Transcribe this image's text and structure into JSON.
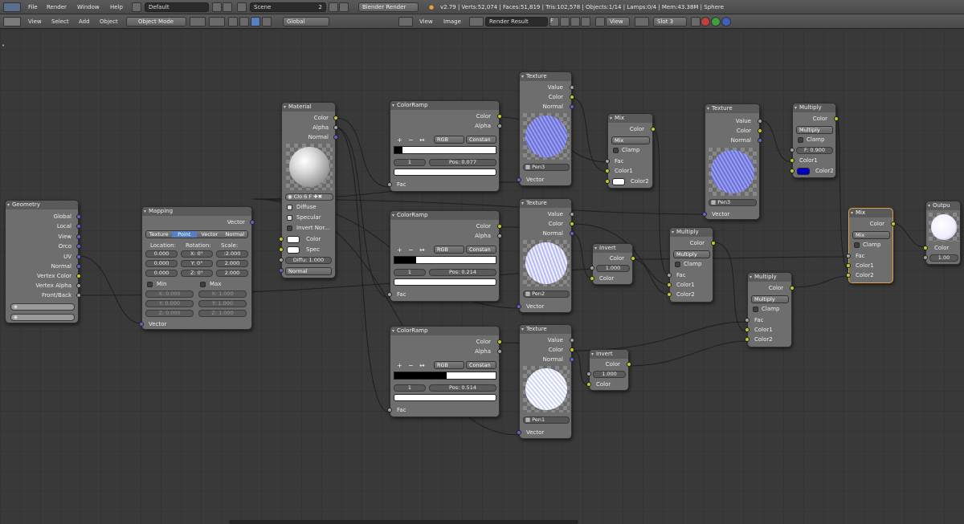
{
  "topbar": {
    "menus": [
      "File",
      "Render",
      "Window",
      "Help"
    ],
    "layout": "Default",
    "scene": "Scene",
    "scene_users": "2",
    "engine": "Blender Render",
    "stats": "v2.79 | Verts:52,074 | Faces:51,819 | Tris:102,578 | Objects:1/14 | Lamps:0/4 | Mem:43.38M | Sphere"
  },
  "viewbar": {
    "items": [
      "View",
      "Select",
      "Add",
      "Object"
    ],
    "mode": "Object Mode",
    "orientation": "Global"
  },
  "imagebar": {
    "items": [
      "View",
      "Image"
    ],
    "image": "Render Result",
    "fake_user": "F",
    "view": "View",
    "slot": "Slot 3"
  },
  "nodes": {
    "geometry": {
      "title": "Geometry",
      "outputs": [
        "Global",
        "Local",
        "View",
        "Orco",
        "UV",
        "Normal",
        "Vertex Color",
        "Vertex Alpha",
        "Front/Back"
      ]
    },
    "mapping": {
      "title": "Mapping",
      "output": "Vector",
      "tabs": [
        "Texture",
        "Point",
        "Vector",
        "Normal"
      ],
      "active_tab": "Point",
      "col_location": "Location:",
      "col_rotation": "Rotation:",
      "col_scale": "Scale:",
      "loc": [
        "0.000",
        "0.000",
        "0.000"
      ],
      "rot": [
        "X:",
        "Y:",
        "Z:"
      ],
      "rot_vals": [
        "0°",
        "0°",
        "0°"
      ],
      "scale": [
        ":2.000",
        "2.000",
        "2.000"
      ],
      "min": "Min",
      "max": "Max",
      "min_vals": [
        "X:",
        "Y:",
        "Z:"
      ],
      "min_nums": [
        "0.000",
        "0.000",
        "0.000"
      ],
      "max_vals": [
        "X:",
        "Y:",
        "Z:"
      ],
      "max_nums": [
        "1.000",
        "1.000",
        "1.000"
      ],
      "input": "Vector"
    },
    "material": {
      "title": "Material",
      "outputs": [
        "Color",
        "Alpha",
        "Normal"
      ],
      "mat_name": "Clo",
      "mat_users": "6",
      "mat_fake": "F",
      "diffuse": "Diffuse",
      "specular": "Specular",
      "invert_normal": "Invert Nor...",
      "in_color": "Color",
      "in_spec": "Spec",
      "in_diffuse": "Diffu: 1.000",
      "in_normal": "Normal"
    },
    "ramp1": {
      "title": "ColorRamp",
      "outputs": [
        "Color",
        "Alpha"
      ],
      "mode": "RGB",
      "interp": "Constan",
      "index": "1",
      "pos": "0.077",
      "fac": "Fac"
    },
    "ramp2": {
      "title": "ColorRamp",
      "outputs": [
        "Color",
        "Alpha"
      ],
      "mode": "RGB",
      "interp": "Constan",
      "index": "1",
      "pos": "0.214",
      "fac": "Fac"
    },
    "ramp3": {
      "title": "ColorRamp",
      "outputs": [
        "Color",
        "Alpha"
      ],
      "mode": "RGB",
      "interp": "Constan",
      "index": "1",
      "pos": "0.514",
      "fac": "Fac"
    },
    "ramp_buttons": [
      "+",
      "−",
      "↔"
    ],
    "pos_label": "Pos:",
    "tex1": {
      "title": "Texture",
      "outputs": [
        "Value",
        "Color",
        "Normal"
      ],
      "name": "Pen3",
      "input": "Vector"
    },
    "tex2": {
      "title": "Texture",
      "outputs": [
        "Value",
        "Color",
        "Normal"
      ],
      "name": "Pen2",
      "input": "Vector"
    },
    "tex3": {
      "title": "Texture",
      "outputs": [
        "Value",
        "Color",
        "Normal"
      ],
      "name": "Pen1",
      "input": "Vector"
    },
    "tex4": {
      "title": "Texture",
      "outputs": [
        "Value",
        "Color",
        "Normal"
      ],
      "name": "Pen3",
      "input": "Vector"
    },
    "mix1": {
      "title": "Mix",
      "output": "Color",
      "blend": "Mix",
      "clamp": "Clamp",
      "inputs": [
        "Fac",
        "Color1",
        "Color2"
      ]
    },
    "invert1": {
      "title": "Invert",
      "output": "Color",
      "fac": "1.000",
      "color": "Color"
    },
    "invert2": {
      "title": "Invert",
      "output": "Color",
      "fac": "1.000",
      "color": "Color"
    },
    "multiply1": {
      "title": "Multiply",
      "output": "Color",
      "blend": "Multiply",
      "clamp": "Clamp",
      "inputs": [
        "Fac",
        "Color1",
        "Color2"
      ]
    },
    "multiply2": {
      "title": "Multiply",
      "output": "Color",
      "blend": "Multiply",
      "clamp": "Clamp",
      "inputs": [
        "Fac",
        "Color1",
        "Color2"
      ]
    },
    "multiply3": {
      "title": "Multiply",
      "output": "Color",
      "blend": "Multiply",
      "clamp": "Clamp",
      "fac": "F: 0.900",
      "inputs": [
        "Color1",
        "Color2"
      ]
    },
    "mix2": {
      "title": "Mix",
      "output": "Color",
      "blend": "Mix",
      "clamp": "Clamp",
      "inputs": [
        "Fac",
        "Color1",
        "Color2"
      ]
    },
    "output": {
      "title": "Outpu",
      "color": "Color",
      "alpha": "1.00"
    }
  },
  "colors": {
    "socket_color": "#c7c729",
    "socket_value": "#a1a1a1",
    "socket_vector": "#6363c7",
    "accent_blue": "#5680c2",
    "selected_border": "#e0a044",
    "color2_swatch": "#0000c8"
  }
}
